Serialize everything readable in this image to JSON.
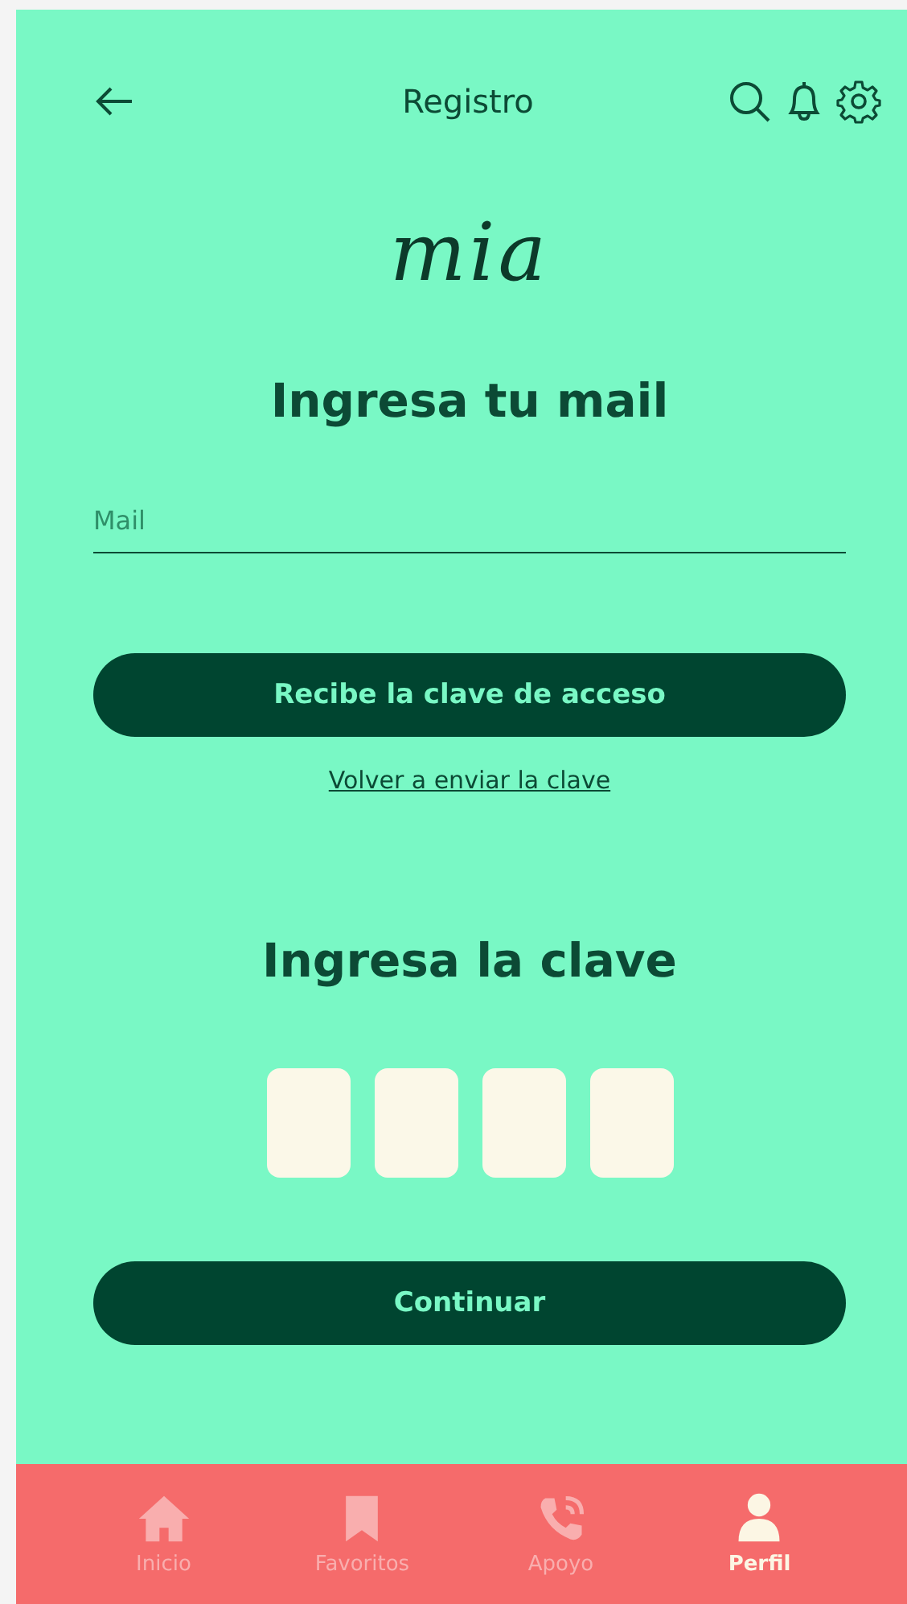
{
  "header": {
    "title": "Registro"
  },
  "logo": "mia",
  "email_section": {
    "heading": "Ingresa tu mail",
    "field": {
      "placeholder": "Mail"
    },
    "button": "Recibe la clave de acceso",
    "link": "Volver a enviar la clave"
  },
  "code_section": {
    "heading": "Ingresa la clave",
    "digits": [
      {
        "filled": false
      },
      {
        "filled": false
      },
      {
        "filled": false
      },
      {
        "filled": false
      }
    ]
  },
  "continue_button": "Continuar",
  "nav": [
    {
      "kind": "home",
      "label": "Inicio",
      "selected": false
    },
    {
      "kind": "bookmark",
      "label": "Favoritos",
      "selected": false
    },
    {
      "kind": "phone",
      "label": "Apoyo",
      "selected": false
    },
    {
      "kind": "person",
      "label": "Perfil",
      "selected": true
    }
  ]
}
